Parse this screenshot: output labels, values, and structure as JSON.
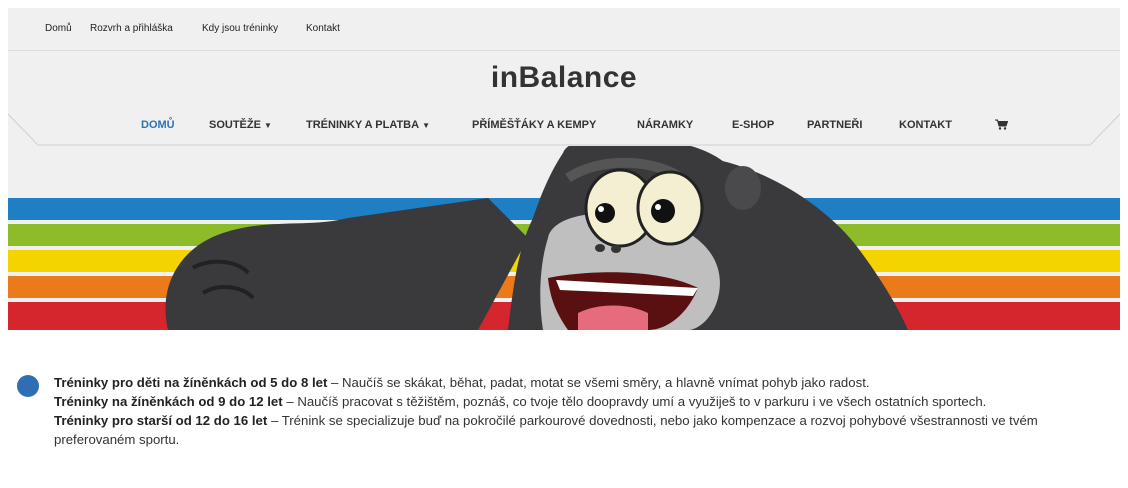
{
  "topbar": {
    "links": [
      "Domů",
      "Rozvrh a přihláška",
      "Kdy jsou tréninky",
      "Kontakt"
    ]
  },
  "site": {
    "logo": "inBalance"
  },
  "nav": {
    "items": [
      {
        "label": "DOMŮ",
        "active": true
      },
      {
        "label": "SOUTĚŽE",
        "dropdown": true
      },
      {
        "label": "TRÉNINKY A PLATBA",
        "dropdown": true
      },
      {
        "label": "PŘÍMĚŠŤÁKY A KEMPY"
      },
      {
        "label": "NÁRAMKY"
      },
      {
        "label": "E-SHOP"
      },
      {
        "label": "PARTNEŘI"
      },
      {
        "label": "KONTAKT"
      }
    ],
    "cart_icon": "shopping-cart-icon"
  },
  "hero": {
    "stripe_colors": [
      "#1f7fc4",
      "#8cbc2a",
      "#f3d400",
      "#ea7a1a",
      "#d6262d"
    ],
    "mascot": "gorilla-mascot"
  },
  "content": {
    "p1_bold": "Tréninky pro děti na žíněnkách od 5 do 8 let",
    "p1_text": " – Naučíš se skákat, běhat, padat, motat se všemi směry, a hlavně vnímat pohyb jako radost.",
    "p2_bold": "Tréninky na žíněnkách od 9 do 12 let",
    "p2_text": " – Naučíš pracovat s těžištěm, poznáš, co tvoje tělo doopravdy umí a využiješ to v parkuru i ve všech ostatních sportech.",
    "p3_bold": "Tréninky pro starší od 12 do 16 let",
    "p3_text": " – Trénink se specializuje buď na pokročilé parkourové dovednosti, nebo jako kompenzace a rozvoj pohybové všestrannosti ve tvém preferovaném sportu."
  }
}
